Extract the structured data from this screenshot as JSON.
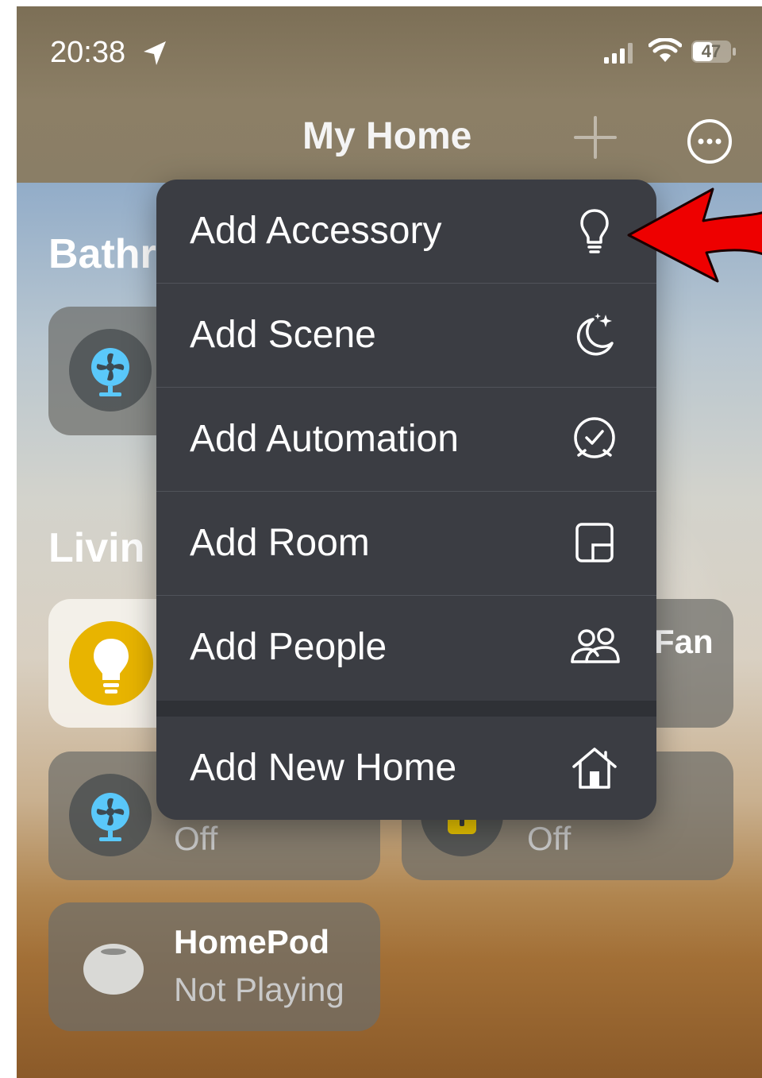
{
  "status_bar": {
    "time": "20:38",
    "battery": "47"
  },
  "header": {
    "title": "My Home"
  },
  "background": {
    "bathroom_title": "Bathr",
    "living_title": "Livin",
    "tiles": [
      {
        "name": "",
        "state": ""
      },
      {
        "name": "",
        "state": ""
      },
      {
        "name": "Fan",
        "state": ""
      },
      {
        "name": "",
        "state": "Off"
      },
      {
        "name": "",
        "state": "Off"
      },
      {
        "name": "HomePod",
        "state": "Not Playing"
      }
    ]
  },
  "menu": {
    "items": [
      {
        "label": "Add Accessory",
        "icon": "lightbulb-icon"
      },
      {
        "label": "Add Scene",
        "icon": "moon-sparkle-icon"
      },
      {
        "label": "Add Automation",
        "icon": "clock-automation-icon"
      },
      {
        "label": "Add Room",
        "icon": "room-icon"
      },
      {
        "label": "Add People",
        "icon": "people-icon"
      },
      {
        "label": "Add New Home",
        "icon": "house-icon"
      }
    ]
  },
  "colors": {
    "menu_bg": "#3b3d43",
    "accent_yellow": "#e8b400",
    "fan_blue": "#5ac8fa",
    "arrow_red": "#ee0000"
  }
}
